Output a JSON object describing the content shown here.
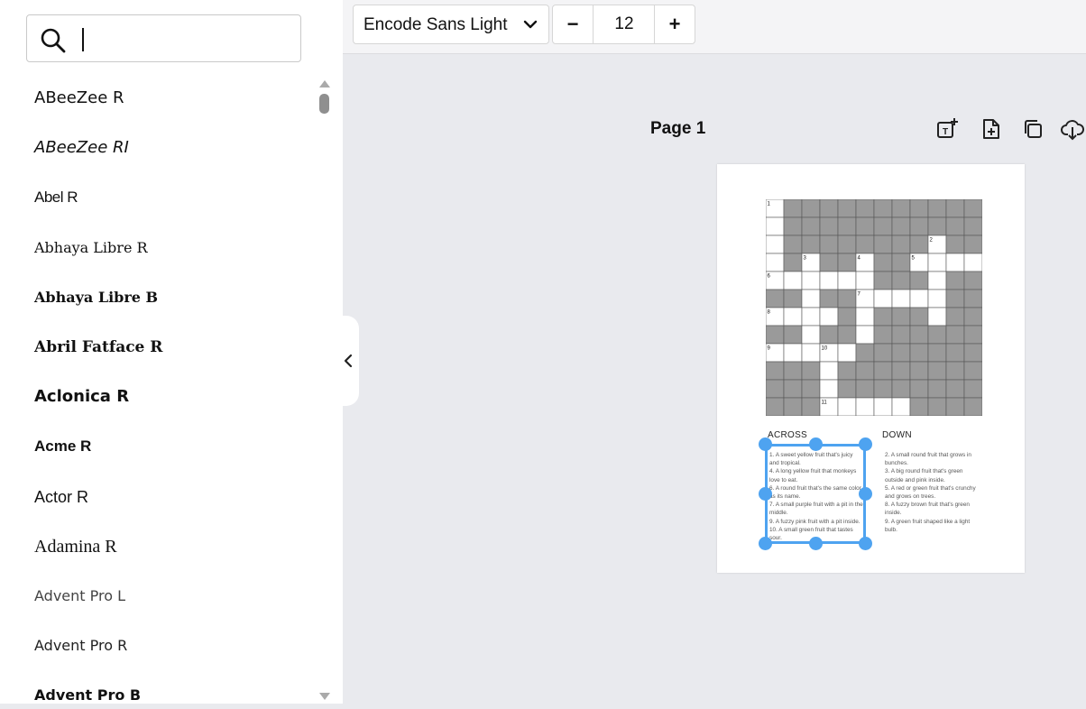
{
  "search": {
    "placeholder": ""
  },
  "fonts": [
    {
      "label": "ABeeZee R",
      "family": "\"DejaVu Sans\", sans-serif",
      "size": 18,
      "weight": "normal",
      "style": "normal"
    },
    {
      "label": "ABeeZee RI",
      "family": "\"DejaVu Sans\", sans-serif",
      "size": 18,
      "weight": "normal",
      "style": "italic"
    },
    {
      "label": "Abel R",
      "family": "\"Liberation Sans\", sans-serif",
      "size": 17,
      "weight": "normal",
      "style": "normal",
      "stretch": "condensed"
    },
    {
      "label": "Abhaya Libre R",
      "family": "\"DejaVu Serif\", serif",
      "size": 16,
      "weight": "normal",
      "style": "normal"
    },
    {
      "label": "Abhaya Libre B",
      "family": "\"DejaVu Serif\", serif",
      "size": 16,
      "weight": "bold",
      "style": "normal"
    },
    {
      "label": "Abril Fatface R",
      "family": "\"DejaVu Serif\", serif",
      "size": 17,
      "weight": "bold",
      "style": "normal"
    },
    {
      "label": "Aclonica R",
      "family": "\"DejaVu Sans\", sans-serif",
      "size": 18,
      "weight": "bold",
      "style": "normal"
    },
    {
      "label": "Acme R",
      "family": "\"Liberation Sans\", sans-serif",
      "size": 17,
      "weight": "bold",
      "style": "normal"
    },
    {
      "label": "Actor R",
      "family": "\"Liberation Sans\", sans-serif",
      "size": 18,
      "weight": "normal",
      "style": "normal"
    },
    {
      "label": "Adamina R",
      "family": "\"Liberation Serif\", serif",
      "size": 20,
      "weight": "normal",
      "style": "normal"
    },
    {
      "label": "Advent Pro L",
      "family": "\"DejaVu Sans\", sans-serif",
      "size": 16,
      "weight": "normal",
      "style": "normal",
      "color": "#444"
    },
    {
      "label": "Advent Pro R",
      "family": "\"DejaVu Sans\", sans-serif",
      "size": 16,
      "weight": "normal",
      "style": "normal",
      "color": "#222"
    },
    {
      "label": "Advent Pro B",
      "family": "\"DejaVu Sans\", sans-serif",
      "size": 16,
      "weight": "bold",
      "style": "normal"
    }
  ],
  "toolbar": {
    "font_name": "Encode Sans Light",
    "minus_label": "−",
    "font_size": "12",
    "plus_label": "+"
  },
  "page": {
    "title": "Page 1"
  },
  "crossword": {
    "rows": [
      "WBBBBBBBBBBB",
      "WBBBBBBBBBBB",
      "WBBBBBBBBWBB",
      "WBWBBWBBWWWW",
      "WWWWWWBBBWBB",
      "BBWBBWWWWWBB",
      "WWWWBWBBBWBB",
      "BBWBBWBBBBBB",
      "WWWWWBBBBBBB",
      "BBBWBBBBBBBB",
      "BBBWBBBBBBBB",
      "BBBWWWWWBBBB"
    ],
    "numbers": [
      {
        "r": 0,
        "c": 0,
        "n": "1"
      },
      {
        "r": 2,
        "c": 9,
        "n": "2"
      },
      {
        "r": 3,
        "c": 2,
        "n": "3"
      },
      {
        "r": 3,
        "c": 5,
        "n": "4"
      },
      {
        "r": 3,
        "c": 8,
        "n": "5"
      },
      {
        "r": 4,
        "c": 0,
        "n": "6"
      },
      {
        "r": 5,
        "c": 5,
        "n": "7"
      },
      {
        "r": 6,
        "c": 0,
        "n": "8"
      },
      {
        "r": 8,
        "c": 0,
        "n": "9"
      },
      {
        "r": 8,
        "c": 3,
        "n": "10"
      },
      {
        "r": 11,
        "c": 3,
        "n": "11"
      }
    ],
    "across_title": "ACROSS",
    "down_title": "DOWN",
    "across": [
      "1. A sweet yellow fruit that's juicy and tropical.",
      "4. A long yellow fruit that monkeys love to eat.",
      "6. A round fruit that's the same color as its name.",
      "7. A small purple fruit with a pit in the middle.",
      "9. A fuzzy pink fruit with a pit inside.",
      "10. A small green fruit that tastes sour."
    ],
    "down": [
      "2. A small round fruit that grows in bunches.",
      "3. A big round fruit that's green outside and pink inside.",
      "5. A red or green fruit that's crunchy and grows on trees.",
      "8. A fuzzy brown fruit that's green inside.",
      "9. A green fruit shaped like a light bulb."
    ],
    "colors": {
      "block": "#9a9a9a",
      "line": "#555555"
    }
  },
  "colors": {
    "selection": "#4ea3f0",
    "canvas": "#e9eaee"
  }
}
